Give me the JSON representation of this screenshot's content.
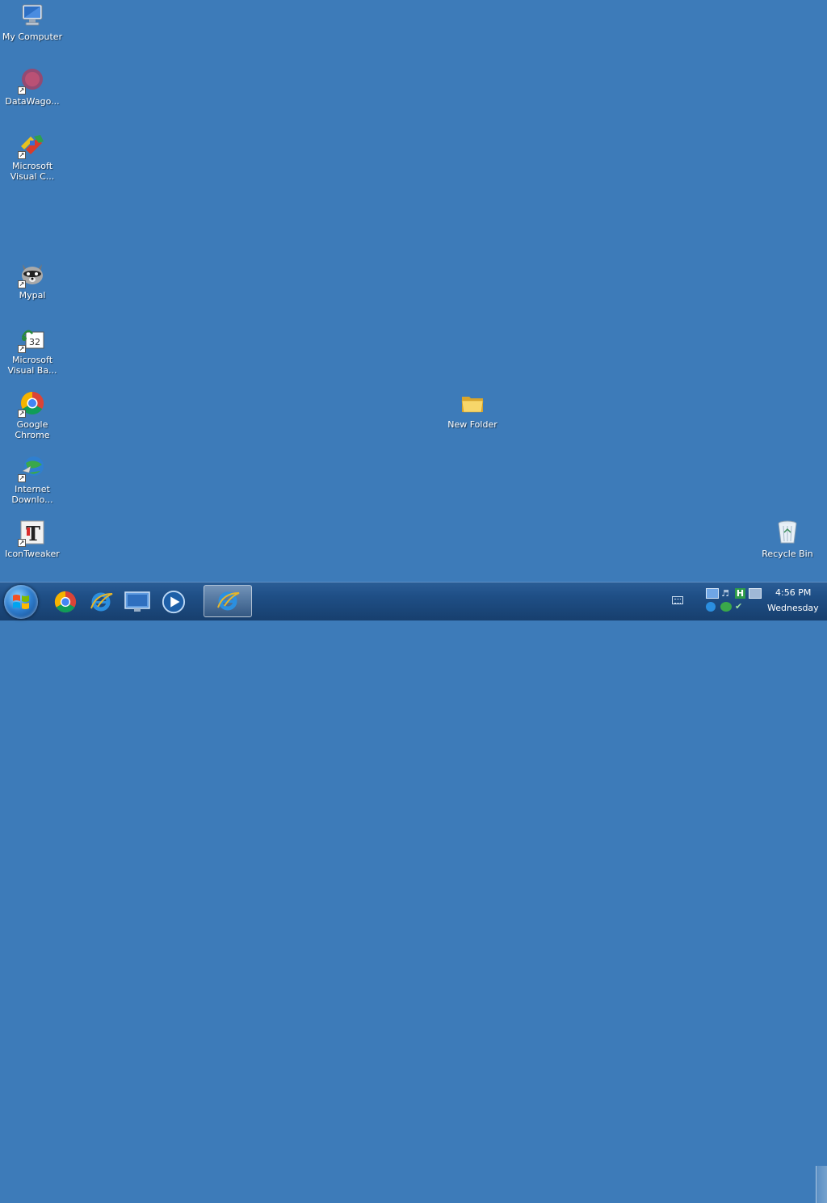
{
  "desktop": {
    "icons": [
      {
        "label": "My Computer",
        "icon": "computer-icon"
      },
      {
        "label": "DataWago...",
        "icon": "datawagon-icon"
      },
      {
        "label": "Microsoft\nVisual C...",
        "icon": "visual-c-icon"
      },
      {
        "label": "Mypal",
        "icon": "mypal-raccoon-icon"
      },
      {
        "label": "Microsoft\nVisual Ba...",
        "icon": "visual-basic-icon"
      },
      {
        "label": "Google\nChrome",
        "icon": "chrome-icon"
      },
      {
        "label": "Internet\nDownlo...",
        "icon": "internet-download-manager-icon"
      },
      {
        "label": "IconTweaker",
        "icon": "icontweaker-icon"
      },
      {
        "label": "New Folder",
        "icon": "folder-icon"
      },
      {
        "label": "Recycle Bin",
        "icon": "recycle-bin-icon"
      }
    ]
  },
  "taskbar": {
    "start_icon": "windows-logo-icon",
    "pinned": [
      {
        "name": "Google Chrome",
        "icon": "chrome-icon"
      },
      {
        "name": "Internet Explorer",
        "icon": "internet-explorer-icon"
      },
      {
        "name": "Desktop",
        "icon": "monitor-icon"
      },
      {
        "name": "Media Player",
        "icon": "media-player-icon"
      }
    ],
    "active_window": {
      "name": "Internet Explorer",
      "icon": "internet-explorer-icon"
    },
    "tray": {
      "keyboard_icon": "keyboard-icon",
      "time": "4:56 PM",
      "day": "Wednesday"
    }
  },
  "colors": {
    "desktop_background": "#3d7bb9",
    "taskbar": "#1f4f86"
  }
}
